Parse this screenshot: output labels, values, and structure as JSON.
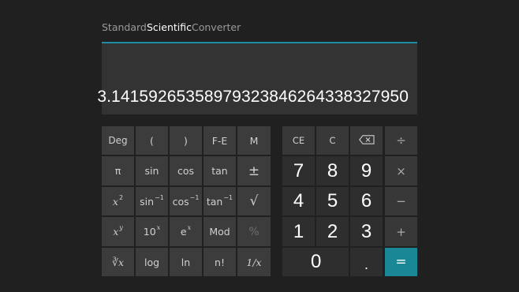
{
  "tabs": {
    "standard": "Standard",
    "scientific": "Scientific",
    "converter": "Converter"
  },
  "display": {
    "value": "3.14159265358979323846264338327950"
  },
  "keys": {
    "deg": "Deg",
    "open_paren": "(",
    "close_paren": ")",
    "fe": "F-E",
    "mem": "M",
    "pi": "π",
    "sin": "sin",
    "cos": "cos",
    "tan": "tan",
    "negate": "±",
    "square_base": "x",
    "square_exp": "2",
    "asin_base": "sin",
    "asin_exp": "−1",
    "acos_base": "cos",
    "acos_exp": "−1",
    "atan_base": "tan",
    "atan_exp": "−1",
    "sqrt": "√",
    "pow_base": "x",
    "pow_exp": "y",
    "ten_pow_base": "10",
    "ten_pow_exp": "x",
    "exp_base": "e",
    "exp_exp": "x",
    "mod": "Mod",
    "percent": "%",
    "root_y": "∛x",
    "log": "log",
    "ln": "ln",
    "factorial": "n!",
    "reciprocal": "1/x",
    "ce": "CE",
    "c": "C",
    "backspace": "⌫",
    "divide": "÷",
    "multiply": "×",
    "minus": "−",
    "plus": "+",
    "equals": "=",
    "decimal": ".",
    "d7": "7",
    "d8": "8",
    "d9": "9",
    "d4": "4",
    "d5": "5",
    "d6": "6",
    "d1": "1",
    "d2": "2",
    "d3": "3",
    "d0": "0"
  },
  "colors": {
    "accent": "#1b8ea6",
    "equals_bg": "#1a8796",
    "background": "#202020"
  },
  "icons": {
    "backspace": "backspace-icon"
  }
}
